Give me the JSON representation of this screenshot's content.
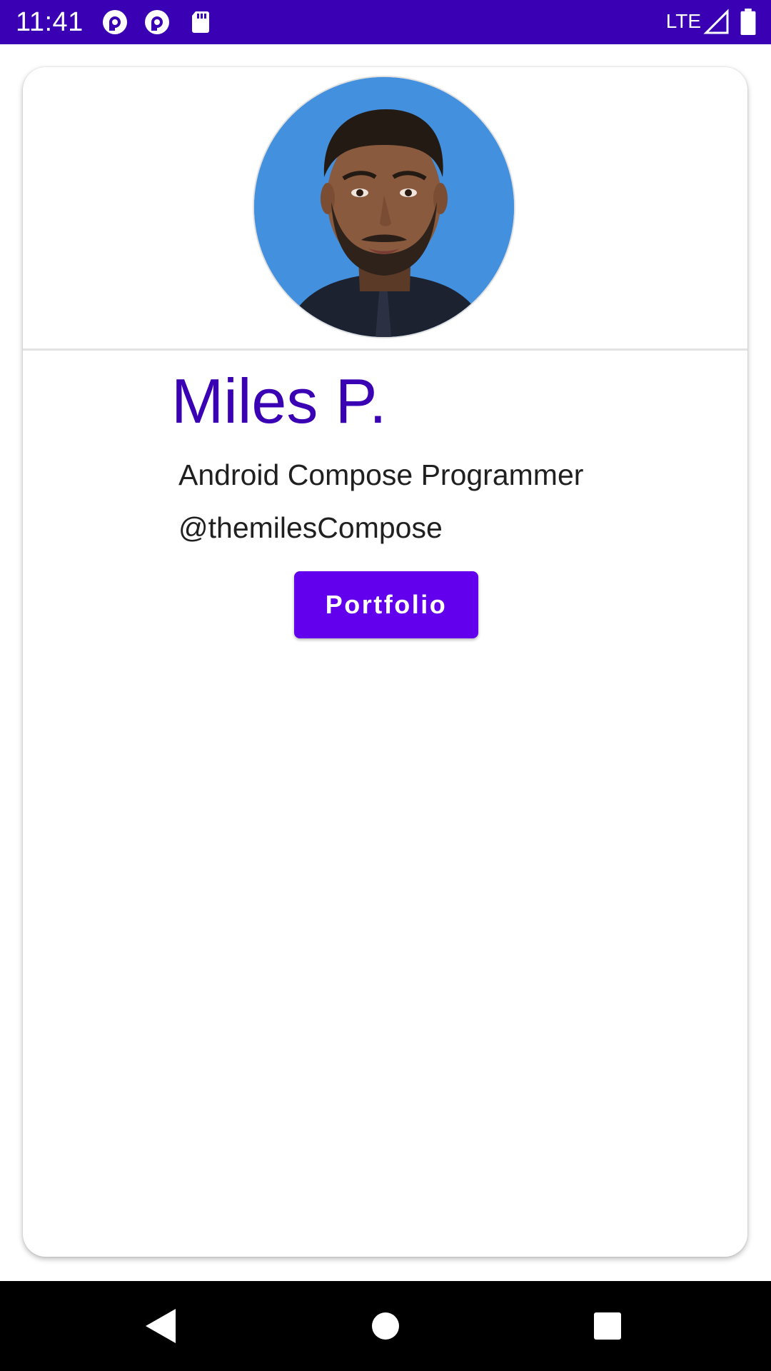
{
  "status_bar": {
    "time": "11:41",
    "network": "LTE",
    "icons": [
      "pocket-casts-icon",
      "pocket-casts-icon",
      "sd-card-icon",
      "signal-icon",
      "battery-icon"
    ],
    "background": "#3a00b3"
  },
  "profile": {
    "avatar": "profile-photo",
    "avatar_background": "#4390de",
    "name": "Miles P.",
    "title": "Android Compose Programmer",
    "handle": "@themilesCompose",
    "name_color": "#3a00b3"
  },
  "actions": {
    "portfolio_label": "Portfolio",
    "button_color": "#6200ee"
  },
  "nav_bar": {
    "icons": [
      "back-icon",
      "home-icon",
      "recents-icon"
    ]
  }
}
